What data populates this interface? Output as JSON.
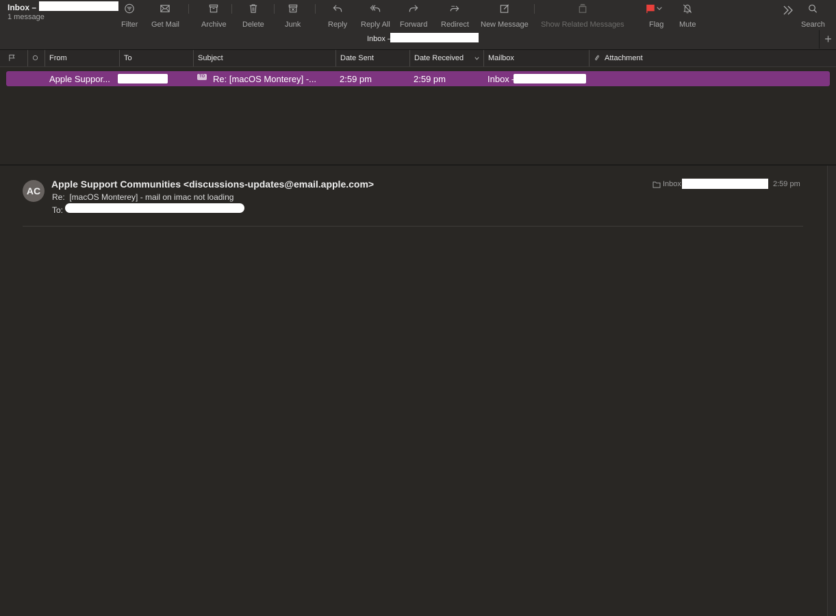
{
  "window": {
    "title": "Inbox –",
    "subtitle": "1 message"
  },
  "toolbar": {
    "filter": "Filter",
    "get_mail": "Get Mail",
    "archive": "Archive",
    "delete": "Delete",
    "junk": "Junk",
    "reply": "Reply",
    "reply_all": "Reply All",
    "forward": "Forward",
    "redirect": "Redirect",
    "new_message": "New Message",
    "show_related": "Show Related Messages",
    "flag": "Flag",
    "mute": "Mute",
    "search": "Search",
    "flag_color": "#e8403b"
  },
  "mailbox_tab": {
    "title": "Inbox –",
    "plus": "+"
  },
  "columns": {
    "from": "From",
    "to": "To",
    "subject": "Subject",
    "date_sent": "Date Sent",
    "date_received": "Date Received",
    "mailbox": "Mailbox",
    "attachment": "Attachment"
  },
  "messages": [
    {
      "from": "Apple Suppor...",
      "to_tag": "TO",
      "subject": "Re:  [macOS Monterey] -...",
      "date_sent": "2:59 pm",
      "date_received": "2:59 pm",
      "mailbox": "Inbox –",
      "highlight_color": "#7e3580"
    }
  ],
  "preview": {
    "avatar": "AC",
    "from": "Apple Support Communities <discussions-updates@email.apple.com>",
    "subject": "Re:  [macOS Monterey] - mail on imac not loading",
    "to_label": "To:",
    "mailbox": "Inbox",
    "time": "2:59 pm"
  }
}
